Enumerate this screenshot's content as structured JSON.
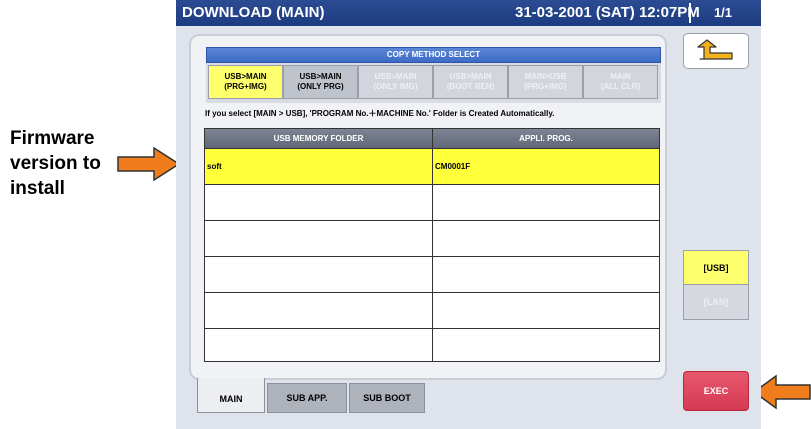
{
  "annotations": {
    "firmware_label_line1": "Firmware",
    "firmware_label_line2": "version to",
    "firmware_label_line3": "install",
    "arrow_color": "#f07c1c"
  },
  "titlebar": {
    "title": "DOWNLOAD (MAIN)",
    "datetime": "31-03-2001 (SAT)  12:07PM",
    "page": "1/1"
  },
  "copy_method": {
    "header": "COPY METHOD SELECT",
    "buttons": [
      {
        "label": "USB>MAIN\n(PRG+IMG)",
        "state": "selected"
      },
      {
        "label": "USB>MAIN\n(ONLY PRG)",
        "state": "enabled"
      },
      {
        "label": "USB>MAIN\n(ONLY IMG)",
        "state": "disabled"
      },
      {
        "label": "USB>MAIN\n(BOOT REN)",
        "state": "disabled"
      },
      {
        "label": "MAIN>USB\n(PRG+IMG)",
        "state": "disabled"
      },
      {
        "label": "MAIN\n(ALL CLR)",
        "state": "disabled"
      }
    ]
  },
  "note": "If you select [MAIN > USB], 'PROGRAM No.＋MACHINE No.' Folder is Created Automatically.",
  "table": {
    "headers": [
      "USB MEMORY FOLDER",
      "APPLI. PROG."
    ],
    "rows": [
      [
        "soft",
        "CM0001F"
      ],
      [
        "",
        ""
      ],
      [
        "",
        ""
      ],
      [
        "",
        ""
      ],
      [
        "",
        ""
      ],
      [
        "",
        ""
      ]
    ]
  },
  "tabs": [
    {
      "label": "MAIN",
      "active": true
    },
    {
      "label": "SUB APP.",
      "active": false
    },
    {
      "label": "SUB BOOT",
      "active": false
    }
  ],
  "side": {
    "usb_label": "[USB]",
    "lan_label": "[LAN]",
    "exec_label": "EXEC"
  },
  "colors": {
    "title_bar": "#1d3b80",
    "selected": "#ffff6e",
    "highlight_row": "#ffff3a",
    "exec": "#d53a55"
  }
}
